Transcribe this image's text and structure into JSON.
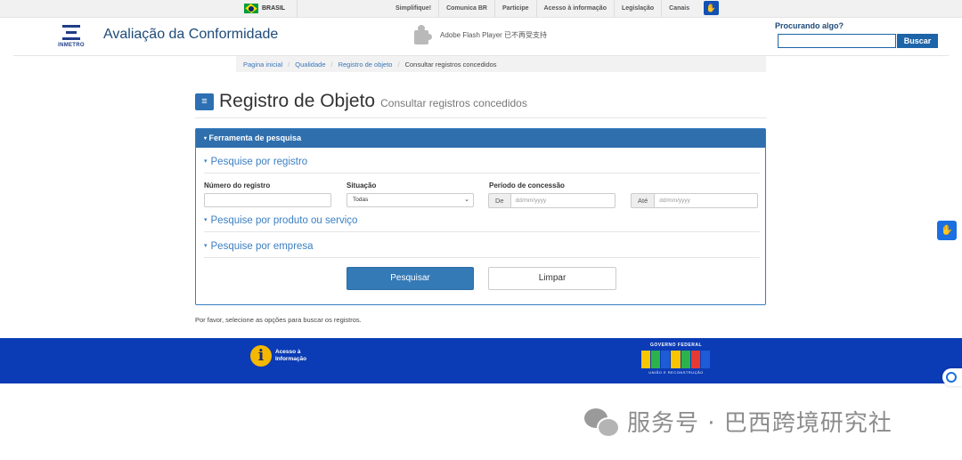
{
  "gov_bar": {
    "country": "BRASIL",
    "links": [
      "Simplifique!",
      "Comunica BR",
      "Participe",
      "Acesso à informação",
      "Legislação",
      "Canais"
    ]
  },
  "header": {
    "logo_text": "INMETRO",
    "site_title": "Avaliação da Conformidade",
    "flash_notice": "Adobe Flash Player 已不再受支持",
    "search_label": "Procurando algo?",
    "search_placeholder": "",
    "search_button": "Buscar"
  },
  "breadcrumb": [
    "Pagina inicial",
    "Qualidade",
    "Registro de objeto",
    "Consultar registros concedidos"
  ],
  "page": {
    "title": "Registro de Objeto",
    "subtitle": "Consultar registros concedidos"
  },
  "search_panel": {
    "header": "Ferramenta de pesquisa",
    "section_registro": "Pesquise por registro",
    "label_numero": "Número do registro",
    "numero_value": "",
    "label_situacao": "Situação",
    "situacao_selected": "Todas",
    "label_periodo": "Período de concessão",
    "de_label": "De",
    "de_placeholder": "dd/mm/yyyy",
    "ate_label": "Até",
    "ate_placeholder": "dd/mm/yyyy",
    "section_produto": "Pesquise por produto ou serviço",
    "section_empresa": "Pesquise por empresa",
    "search_button": "Pesquisar",
    "clear_button": "Limpar"
  },
  "hint": "Por favor, selecione as opções para buscar os registros.",
  "footer": {
    "acesso_info": "Acesso à\nInformação",
    "gov_top": "GOVERNO FEDERAL",
    "gov_bottom": "UNIÃO E RECONSTRUÇÃO"
  },
  "watermark": "服务号 · 巴西跨境研究社",
  "colors": {
    "primary": "#337ab7",
    "panel_header": "#2f6fae",
    "footer": "#0b3bb5",
    "link": "#3a76b8"
  }
}
